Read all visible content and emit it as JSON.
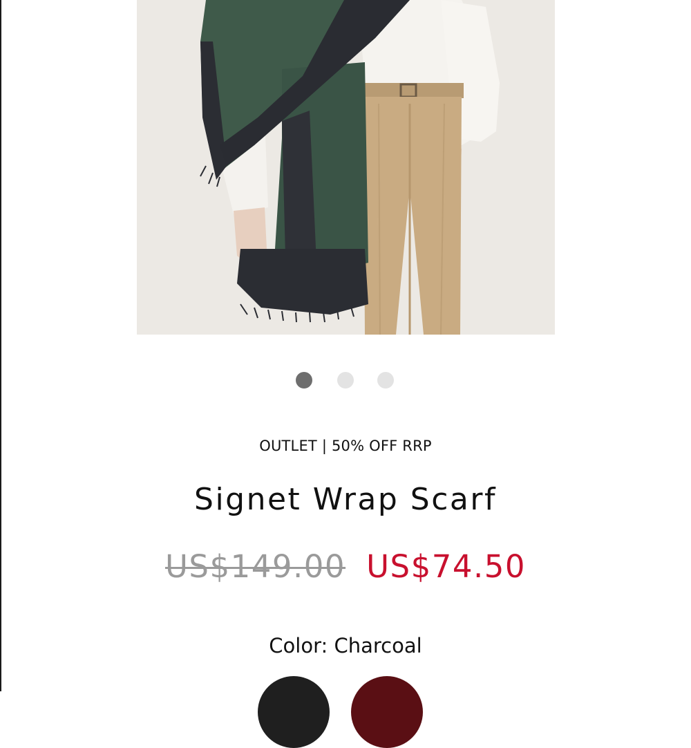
{
  "carousel": {
    "slide_count": 3,
    "active_index": 0
  },
  "product": {
    "promo_label": "OUTLET | 50% OFF RRP",
    "name": "Signet Wrap Scarf",
    "price_original": "US$149.00",
    "price_sale": "US$74.50",
    "color_label": "Color: Charcoal"
  },
  "swatches": [
    {
      "name": "Charcoal",
      "hex": "#1f1f1f",
      "selected": true
    },
    {
      "name": "Burgundy",
      "hex": "#5a0f14",
      "selected": false
    }
  ],
  "colors": {
    "sale_price": "#c8102e",
    "original_price": "#9a9a9a",
    "dot_active": "#6e6e6e",
    "dot_inactive": "#e3e3e3"
  }
}
